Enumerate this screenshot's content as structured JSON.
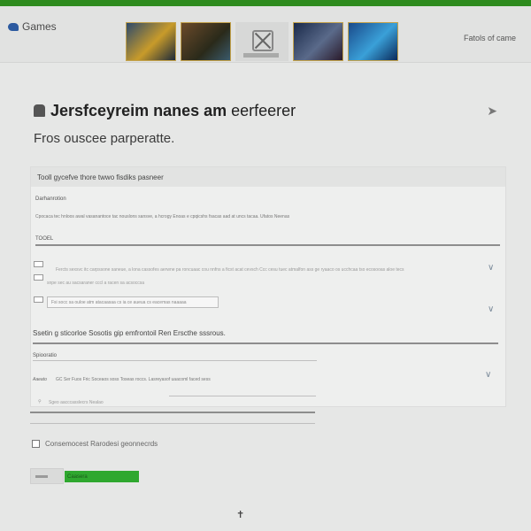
{
  "header": {
    "brand": "Games",
    "right_link": "Fatols of came",
    "thumbnails": [
      "game-cover-1",
      "game-cover-2",
      "xbox-placeholder",
      "game-cover-4",
      "game-cover-5"
    ]
  },
  "page": {
    "title_bold": "Jersfceyreim nanes am",
    "title_normal": "eerfeerer",
    "subtitle": "Fros ouscee parperatte."
  },
  "panel": {
    "heading": "Tooll gycefve thore twwo fisdiks pasneer",
    "sub": "Darhanrotion",
    "desc": "Cpocaca tec hnloos awal vasanantoce tac nouslons sansve, a hcrogy Enoas e cpqicshs fsacas aad at uncs tacaa. Ufatos Neenas",
    "field1_label": "TOOEL",
    "row1_text": "Fercts sexsvc itc carpssone saneue, a lona cassofes aerwne pa roncuaac cou nnfns a ficst acat cevsch Ccc cesu tuec atmalfon ass ge ryaaco os ucchcaa tso ecosooas aloe tecs",
    "row2_text": "snpe sec au sacsaraner cccl a racen sa acsoccsa",
    "row3_text": "Fsi socc sa ouloe atm atacaasaa cs ia ce aueua cs eacemas naaaaa",
    "bold_line": "Ssetin g sticorloe Sosotis gip emfrontoil Ren Erscthe sssrous.",
    "field2_label": "Spiooratio",
    "italic_label": "Aaeato",
    "row4_text": "GC Ser Fuos Fric Soceaos soss Toseas roccs. Lasreyasof uaacoml faced sess",
    "row5_text": "Sgeo aacccasslecrs Nealao"
  },
  "footer": {
    "option_text": "Consemocest Rarodesi geonnecrds",
    "primary_button": "Caasera"
  }
}
